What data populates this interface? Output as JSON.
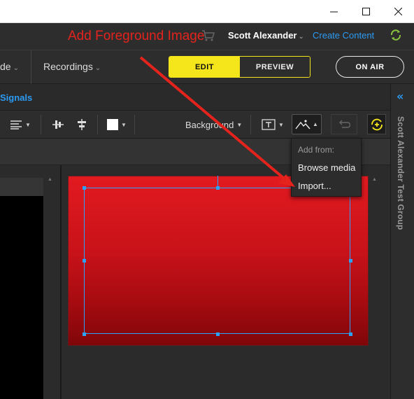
{
  "window": {
    "minimize_icon": "minimize-icon",
    "maximize_icon": "maximize-icon",
    "close_icon": "close-icon"
  },
  "header": {
    "annotation": "Add Foreground Image",
    "user_name": "Scott Alexander",
    "create_content": "Create Content",
    "colors": {
      "annotation": "#e5231d",
      "link": "#2b9bf4"
    }
  },
  "nav": {
    "mode_label": "de",
    "recordings_label": "Recordings",
    "edit_label": "EDIT",
    "preview_label": "PREVIEW",
    "on_air_label": "ON AIR",
    "accent": "#f5e51b"
  },
  "signals": {
    "label": "Signals"
  },
  "toolbar": {
    "background_label": "Background"
  },
  "dropdown": {
    "header": "Add from:",
    "items": [
      "Browse media",
      "Import..."
    ]
  },
  "side_panel": {
    "label": "Scott Alexander Test Group",
    "collapse_icon": "chevron-double-left-icon"
  },
  "canvas": {
    "fill": "#d01419"
  }
}
